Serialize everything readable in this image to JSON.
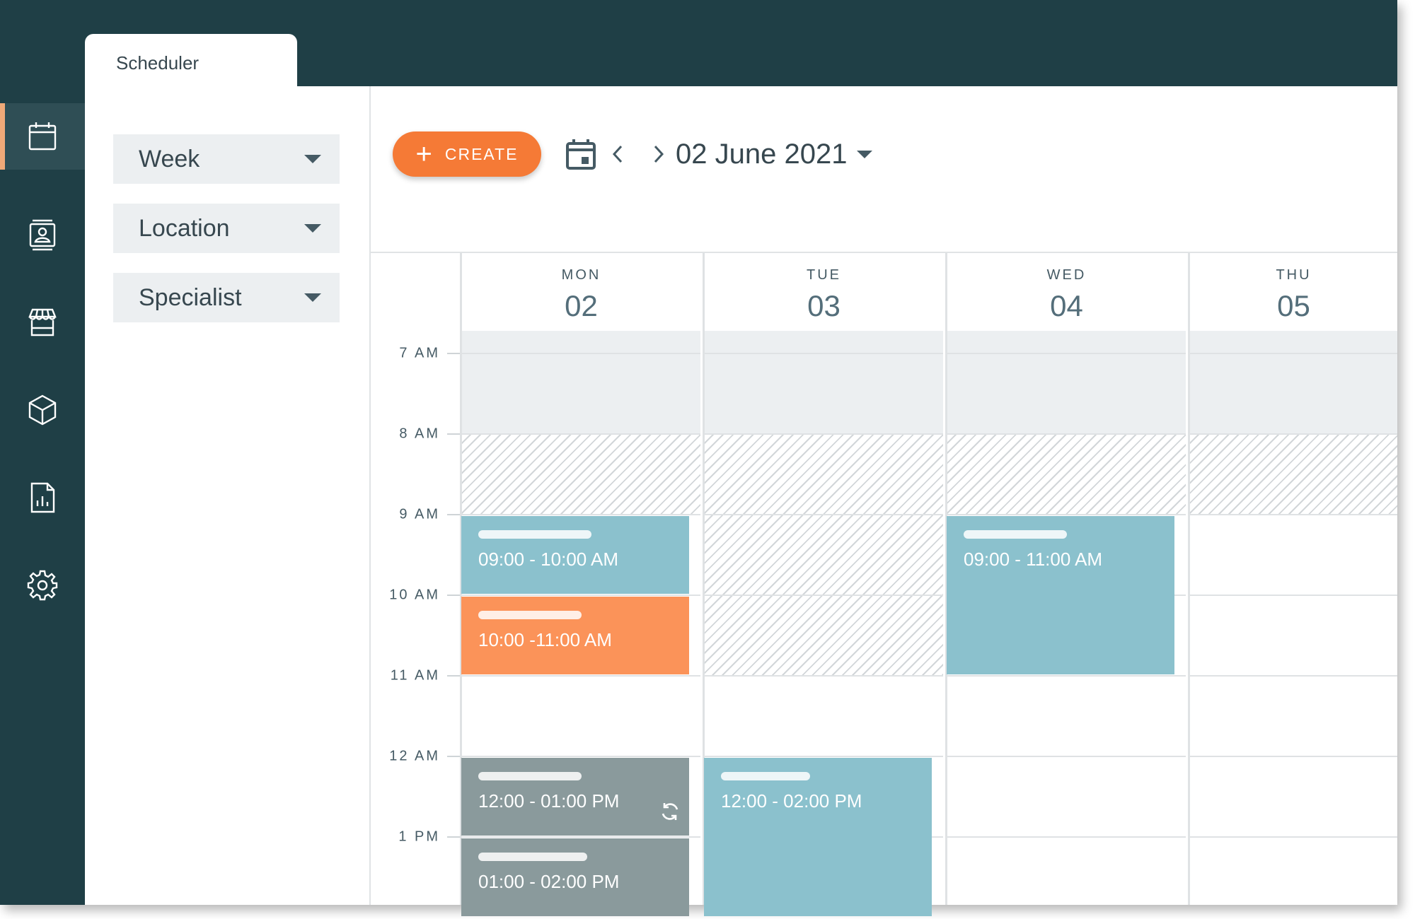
{
  "tab": {
    "title": "Scheduler"
  },
  "sidebar": {
    "items": [
      {
        "icon": "calendar-icon",
        "active": true
      },
      {
        "icon": "contact-card-icon",
        "active": false
      },
      {
        "icon": "store-icon",
        "active": false
      },
      {
        "icon": "box-icon",
        "active": false
      },
      {
        "icon": "report-icon",
        "active": false
      },
      {
        "icon": "gear-icon",
        "active": false
      }
    ]
  },
  "filters": {
    "view": "Week",
    "location": "Location",
    "specialist": "Specialist"
  },
  "toolbar": {
    "create_label": "CREATE",
    "plus": "+",
    "date_label": "02 June 2021"
  },
  "hours": [
    "7 AM",
    "8 AM",
    "9 AM",
    "10 AM",
    "11 AM",
    "12 AM",
    "1 PM"
  ],
  "days": [
    {
      "name": "MON",
      "num": "02"
    },
    {
      "name": "TUE",
      "num": "03"
    },
    {
      "name": "WED",
      "num": "04"
    },
    {
      "name": "THU",
      "num": "05"
    }
  ],
  "events": [
    {
      "day": 0,
      "label": "09:00 - 10:00 AM",
      "color": "#8bc1cd",
      "recurring": false
    },
    {
      "day": 0,
      "label": "10:00 -11:00 AM",
      "color": "#fb9359",
      "recurring": false
    },
    {
      "day": 0,
      "label": "12:00 - 01:00 PM",
      "color": "#8a9a9c",
      "recurring": true
    },
    {
      "day": 0,
      "label": "01:00 - 02:00 PM",
      "color": "#8a9a9c",
      "recurring": false
    },
    {
      "day": 1,
      "label": "12:00 - 02:00 PM",
      "color": "#8bc1cd",
      "recurring": false
    },
    {
      "day": 2,
      "label": "09:00 - 11:00 AM",
      "color": "#8bc1cd",
      "recurring": false
    }
  ],
  "colors": {
    "rail": "#1f3f46",
    "accent": "#f57a36",
    "rail_active_marker": "#f0a978"
  }
}
